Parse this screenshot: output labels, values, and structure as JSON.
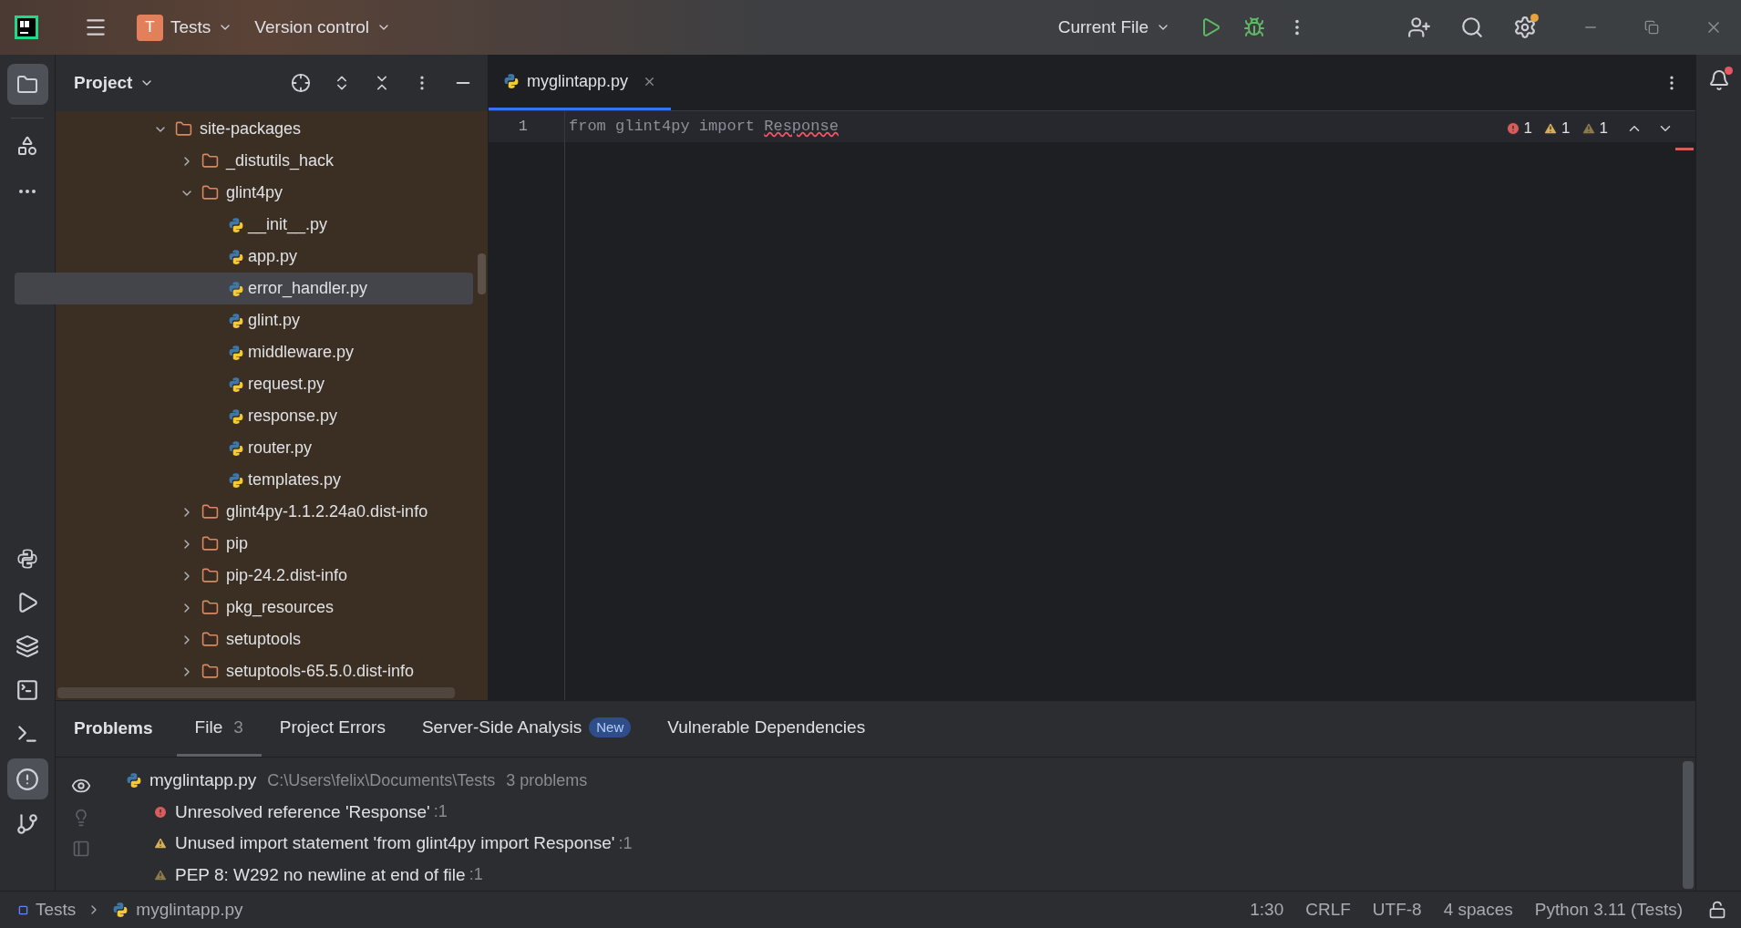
{
  "title_bar": {
    "project": {
      "letter": "T",
      "name": "Tests"
    },
    "vcs": "Version control",
    "run_config": "Current File"
  },
  "project_panel": {
    "title": "Project",
    "tree": [
      {
        "label": "site-packages",
        "kind": "folder",
        "expanded": true,
        "selected": false,
        "children": [
          {
            "label": "_distutils_hack",
            "kind": "folder",
            "expanded": false,
            "selected": false
          },
          {
            "label": "glint4py",
            "kind": "folder",
            "expanded": true,
            "selected": false,
            "children": [
              {
                "label": "__init__.py",
                "kind": "python",
                "selected": false
              },
              {
                "label": "app.py",
                "kind": "python",
                "selected": false
              },
              {
                "label": "error_handler.py",
                "kind": "python",
                "selected": true
              },
              {
                "label": "glint.py",
                "kind": "python",
                "selected": false
              },
              {
                "label": "middleware.py",
                "kind": "python",
                "selected": false
              },
              {
                "label": "request.py",
                "kind": "python",
                "selected": false
              },
              {
                "label": "response.py",
                "kind": "python",
                "selected": false
              },
              {
                "label": "router.py",
                "kind": "python",
                "selected": false
              },
              {
                "label": "templates.py",
                "kind": "python",
                "selected": false
              }
            ]
          },
          {
            "label": "glint4py-1.1.2.24a0.dist-info",
            "kind": "folder",
            "expanded": false,
            "selected": false
          },
          {
            "label": "pip",
            "kind": "folder",
            "expanded": false,
            "selected": false
          },
          {
            "label": "pip-24.2.dist-info",
            "kind": "folder",
            "expanded": false,
            "selected": false
          },
          {
            "label": "pkg_resources",
            "kind": "folder",
            "expanded": false,
            "selected": false
          },
          {
            "label": "setuptools",
            "kind": "folder",
            "expanded": false,
            "selected": false
          },
          {
            "label": "setuptools-65.5.0.dist-info",
            "kind": "folder",
            "expanded": false,
            "selected": false
          }
        ]
      }
    ]
  },
  "editor": {
    "tabs": [
      {
        "label": "myglintapp.py",
        "selected": true
      }
    ],
    "lines": [
      {
        "number": "1",
        "tokens": [
          {
            "text": "from glint4py import ",
            "kind": "plain"
          },
          {
            "text": "Response",
            "kind": "error"
          }
        ]
      }
    ],
    "inspections": [
      {
        "kind": "error",
        "count": "1"
      },
      {
        "kind": "warning",
        "count": "1"
      },
      {
        "kind": "weak",
        "count": "1"
      }
    ]
  },
  "problems": {
    "title": "Problems",
    "tabs": [
      {
        "label": "File",
        "count": "3",
        "selected": true
      },
      {
        "label": "Project Errors",
        "selected": false
      },
      {
        "label": "Server-Side Analysis",
        "badge": "New",
        "selected": false
      },
      {
        "label": "Vulnerable Dependencies",
        "selected": false
      }
    ],
    "file": {
      "name": "myglintapp.py",
      "path": "C:\\Users\\felix\\Documents\\Tests",
      "summary": "3 problems"
    },
    "items": [
      {
        "kind": "error",
        "text": "Unresolved reference 'Response'",
        "location": ":1"
      },
      {
        "kind": "warning",
        "text": "Unused import statement 'from glint4py import Response'",
        "location": ":1"
      },
      {
        "kind": "weak",
        "text": "PEP 8: W292 no newline at end of file",
        "location": ":1"
      }
    ]
  },
  "status_bar": {
    "breadcrumbs": [
      "Tests",
      "myglintapp.py"
    ],
    "items": [
      "1:30",
      "CRLF",
      "UTF-8",
      "4 spaces",
      "Python 3.11 (Tests)"
    ]
  }
}
